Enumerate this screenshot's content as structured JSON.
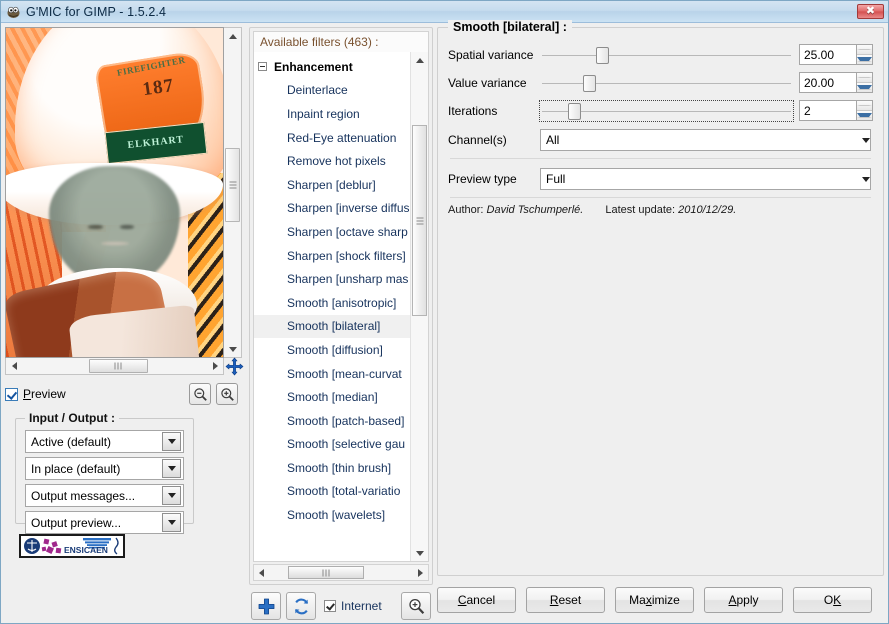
{
  "window": {
    "title": "G'MIC for GIMP - 1.5.2.4",
    "icon": "gimp-wilber-icon",
    "close_label": "✖"
  },
  "preview": {
    "checkbox_label_pre": "P",
    "checkbox_label_rest": "review",
    "checked": true,
    "zoom_out_icon": "zoom-out-icon",
    "zoom_in_icon": "zoom-in-icon",
    "move_icon": "move-icon",
    "image": {
      "arc_text": "FIREFIGHTER",
      "number_text": "187",
      "plate_text": "ELKHART"
    }
  },
  "io": {
    "title": "Input / Output :",
    "selects": [
      {
        "value": "Active (default)"
      },
      {
        "value": "In place (default)"
      },
      {
        "value": "Output messages..."
      },
      {
        "value": "Output preview..."
      }
    ],
    "logo_text": "ENSICAEN"
  },
  "filters": {
    "header": "Available filters (463) :",
    "category": "Enhancement",
    "items": [
      {
        "label": "Deinterlace",
        "selected": false
      },
      {
        "label": "Inpaint region",
        "selected": false
      },
      {
        "label": "Red-Eye attenuation",
        "selected": false
      },
      {
        "label": "Remove hot pixels",
        "selected": false
      },
      {
        "label": "Sharpen [deblur]",
        "selected": false
      },
      {
        "label": "Sharpen [inverse diffus",
        "selected": false
      },
      {
        "label": "Sharpen [octave sharp",
        "selected": false
      },
      {
        "label": "Sharpen [shock filters]",
        "selected": false
      },
      {
        "label": "Sharpen [unsharp mas",
        "selected": false
      },
      {
        "label": "Smooth [anisotropic]",
        "selected": false
      },
      {
        "label": "Smooth [bilateral]",
        "selected": true
      },
      {
        "label": "Smooth [diffusion]",
        "selected": false
      },
      {
        "label": "Smooth [mean-curvat",
        "selected": false
      },
      {
        "label": "Smooth [median]",
        "selected": false
      },
      {
        "label": "Smooth [patch-based]",
        "selected": false
      },
      {
        "label": "Smooth [selective gau",
        "selected": false
      },
      {
        "label": "Smooth [thin brush]",
        "selected": false
      },
      {
        "label": "Smooth [total-variatio",
        "selected": false
      },
      {
        "label": "Smooth [wavelets]",
        "selected": false
      }
    ],
    "tools": {
      "add_icon": "plus-icon",
      "refresh_icon": "refresh-icon",
      "internet_label": "Internet",
      "internet_checked": true,
      "search_icon": "magnifier-icon"
    }
  },
  "params": {
    "title": "Smooth [bilateral] :",
    "sliders": [
      {
        "label": "Spatial variance",
        "value": "25.00",
        "thumb_pct": 22,
        "focused": false
      },
      {
        "label": "Value variance",
        "value": "20.00",
        "thumb_pct": 17,
        "focused": false
      },
      {
        "label": "Iterations",
        "value": "2",
        "thumb_pct": 11,
        "focused": true
      }
    ],
    "combos": [
      {
        "label": "Channel(s)",
        "value": "All"
      },
      {
        "label": "Preview type",
        "value": "Full"
      }
    ],
    "author_prefix": "Author:",
    "author_name": "David Tschumperlé.",
    "update_prefix": "Latest update:",
    "update_value": "2010/12/29."
  },
  "buttons": [
    {
      "accel": "C",
      "rest": "ancel",
      "name": "cancel-button"
    },
    {
      "accel": "R",
      "rest": "eset",
      "name": "reset-button"
    },
    {
      "pre": "Ma",
      "accel": "x",
      "rest": "imize",
      "name": "maximize-button"
    },
    {
      "accel": "A",
      "rest": "pply",
      "name": "apply-button"
    },
    {
      "pre": "O",
      "accel": "K",
      "rest": "",
      "name": "ok-button"
    }
  ]
}
